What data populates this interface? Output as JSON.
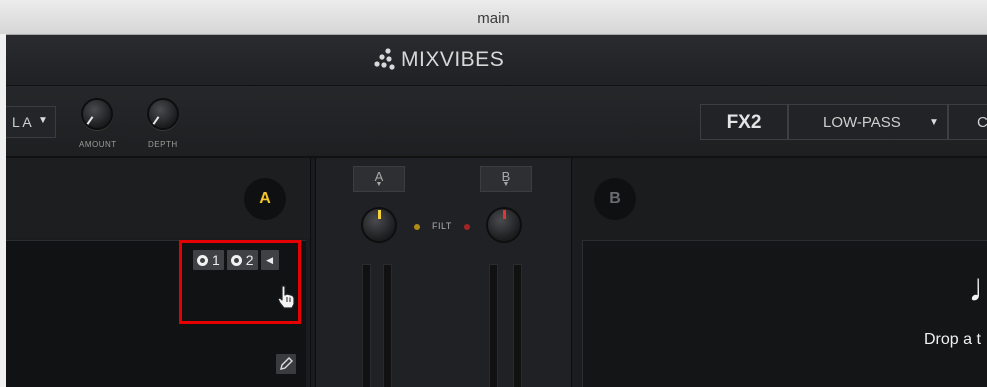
{
  "window": {
    "title": "main"
  },
  "brand": {
    "name": "MIXVIBES"
  },
  "fx_left": {
    "selector_label": "L A",
    "knobs": [
      {
        "label": "AMOUNT"
      },
      {
        "label": "DEPTH"
      }
    ]
  },
  "fx_right": {
    "unit_label": "FX2",
    "effect_label": "LOW-PASS",
    "next_label": "C"
  },
  "deck_a": {
    "badge": "A",
    "badge_color": "#f2c431",
    "cue_1": "1",
    "cue_2": "2"
  },
  "mixer": {
    "channel_a": "A",
    "channel_b": "B",
    "filter_label": "FILT",
    "knob_a_color": "#f3d23a",
    "knob_b_color": "#e23434"
  },
  "deck_b": {
    "badge": "B",
    "badge_color": "#6a6b6e",
    "drop_text": "Drop a t"
  }
}
